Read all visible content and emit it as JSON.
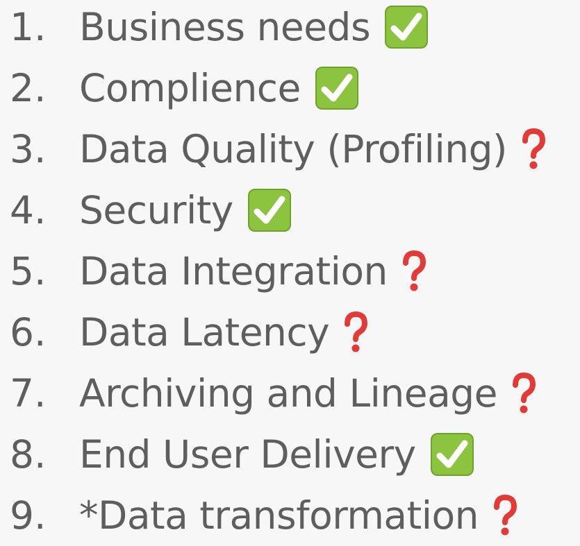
{
  "items": [
    {
      "number": "1.",
      "label": "Business needs",
      "status": "check",
      "status_icon": "check-mark-button-icon"
    },
    {
      "number": "2.",
      "label": "Complience",
      "status": "check",
      "status_icon": "check-mark-button-icon"
    },
    {
      "number": "3.",
      "label": "Data Quality (Profiling)",
      "status": "question",
      "status_icon": "red-question-mark-icon"
    },
    {
      "number": "4.",
      "label": "Security",
      "status": "check",
      "status_icon": "check-mark-button-icon"
    },
    {
      "number": "5.",
      "label": "Data Integration",
      "status": "question",
      "status_icon": "red-question-mark-icon"
    },
    {
      "number": "6.",
      "label": "Data Latency",
      "status": "question",
      "status_icon": "red-question-mark-icon"
    },
    {
      "number": "7.",
      "label": "Archiving and Lineage",
      "status": "question",
      "status_icon": "red-question-mark-icon"
    },
    {
      "number": "8.",
      "label": "End User Delivery",
      "status": "check",
      "status_icon": "check-mark-button-icon"
    },
    {
      "number": "9.",
      "label": "*Data transformation",
      "status": "question",
      "status_icon": "red-question-mark-icon"
    }
  ],
  "colors": {
    "background": "#f7f7f7",
    "text": "#5e5e5e",
    "check_fill": "#8cc43f",
    "question_fill": "#e53935"
  }
}
